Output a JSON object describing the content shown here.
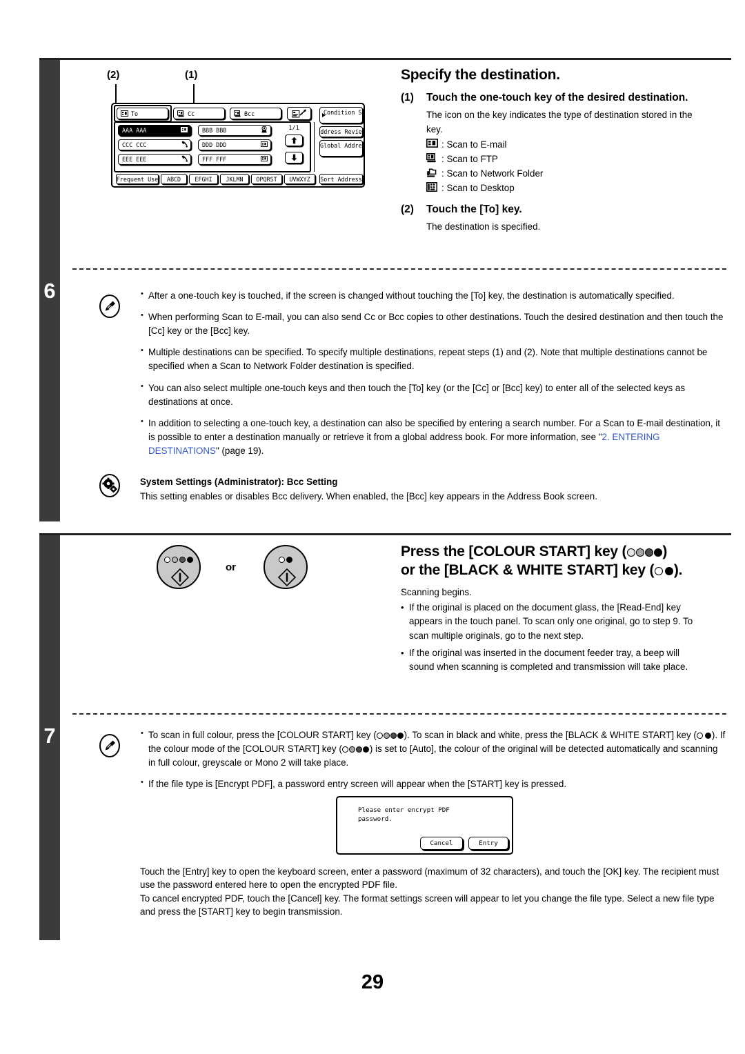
{
  "page": {
    "number": "29"
  },
  "steps": [
    {
      "number": "6",
      "heading": "Specify the destination.",
      "substeps": [
        {
          "marker": "(1)",
          "title": "Touch the one-touch key of the desired destination.",
          "body": "The icon on the key indicates the type of destination stored in the key.",
          "icon_legend": [
            {
              "icon": "scan-to-email-icon",
              "label": ": Scan to E-mail"
            },
            {
              "icon": "scan-to-ftp-icon",
              "label": ": Scan to FTP"
            },
            {
              "icon": "scan-to-network-folder-icon",
              "label": ": Scan to Network Folder"
            },
            {
              "icon": "scan-to-desktop-icon",
              "label": ": Scan to Desktop"
            }
          ]
        },
        {
          "marker": "(2)",
          "title": "Touch the [To] key.",
          "body": "The destination is specified."
        }
      ],
      "notes": [
        "After a one-touch key is touched, if the screen is changed without touching the [To] key, the destination is automatically specified.",
        "When performing Scan to E-mail, you can also send Cc or Bcc copies to other destinations. Touch the desired destination and then touch the [Cc] key or the [Bcc] key.",
        "Multiple destinations can be specified. To specify multiple destinations, repeat steps (1) and (2). Note that multiple destinations cannot be specified when a Scan to Network Folder destination is specified.",
        "You can also select multiple one-touch keys and then touch the [To] key (or the [Cc] or [Bcc] key) to enter all of the selected keys as destinations at once."
      ],
      "note_with_link": {
        "before": "In addition to selecting a one-touch key, a destination can also be specified by entering a search number. For a Scan to E-mail destination, it is possible to enter a destination manually or retrieve it from a global address book. For more information, see \"",
        "link": "2. ENTERING DESTINATIONS",
        "after": "\" (page 19)."
      },
      "system_settings": {
        "title": "System Settings (Administrator): Bcc Setting",
        "body": "This setting enables or disables Bcc delivery. When enabled, the [Bcc] key appears in the Address Book screen."
      },
      "panel": {
        "callouts": [
          {
            "label": "(2)"
          },
          {
            "label": "(1)"
          }
        ],
        "header_keys": [
          {
            "label": "To",
            "icon": "to-email-icon"
          },
          {
            "label": "Cc",
            "icon": "cc-email-icon"
          },
          {
            "label": "Bcc",
            "icon": "bcc-email-icon"
          }
        ],
        "compose_icon": "address-entry-icon",
        "address_keys": [
          {
            "label": "AAA AAA",
            "icon": "email-icon",
            "selected": true
          },
          {
            "label": "BBB BBB",
            "icon": "desktop-icon",
            "selected": false
          },
          {
            "label": "CCC CCC",
            "icon": "fax-icon",
            "selected": false
          },
          {
            "label": "DDD DDD",
            "icon": "email-icon",
            "selected": false
          },
          {
            "label": "EEE EEE",
            "icon": "fax-icon",
            "selected": false
          },
          {
            "label": "FFF FFF",
            "icon": "email-icon",
            "selected": false
          }
        ],
        "page_indicator": "1/1",
        "scroll_up": "scroll-up-arrow-icon",
        "scroll_down": "scroll-down-arrow-icon",
        "side_buttons": [
          {
            "label": "Condition Settings",
            "arrow": true
          },
          {
            "label": "Address Review",
            "arrow": false
          },
          {
            "label": "Global Address Search",
            "arrow": false
          }
        ],
        "tabs": [
          "Frequent Use",
          "ABCD",
          "EFGHI",
          "JKLMN",
          "OPQRST",
          "UVWXYZ"
        ],
        "sort_button": "Sort Address"
      }
    },
    {
      "number": "7",
      "heading_line1_pre": "Press the [COLOUR START] key (",
      "heading_line1_post": ")",
      "heading_line2_pre": "or the [BLACK & WHITE START] key (",
      "heading_line2_post": ").",
      "body": "Scanning begins.",
      "bullets": [
        "If the original is placed on the document glass, the [Read-End] key appears in the touch panel. To scan only one original, go to step 9. To scan multiple originals, go to the next step.",
        "If the original was inserted in the document feeder tray, a beep will sound when scanning is completed and transmission will take place."
      ],
      "or_label": "or",
      "notes": [
        {
          "parts": [
            "To scan in full colour, press the [COLOUR START] key (",
            "). To scan in black and white, press the [BLACK & WHITE START] key (",
            "). If the colour mode of the [COLOUR START] key (",
            ") is set to [Auto], the colour of the original will be detected automatically and scanning in full colour, greyscale or Mono 2 will take place."
          ]
        }
      ],
      "note_simple": "If the file type is [Encrypt PDF], a password entry screen will appear when the [START] key is pressed.",
      "dialog": {
        "message": "Please enter encrypt PDF\npassword.",
        "cancel": "Cancel",
        "entry": "Entry"
      },
      "footer_paragraphs": [
        "Touch the [Entry] key to open the keyboard screen, enter a password (maximum of 32 characters), and touch the [OK] key. The recipient must use the password entered here to open the encrypted PDF file.",
        "To cancel encrypted PDF, touch the [Cancel] key. The format settings screen will appear to let you change the file type. Select a new file type and press the [START] key to begin transmission."
      ]
    }
  ],
  "colors": {
    "link": "#3355cc",
    "bar": "#3b3b3b",
    "rule": "#231f20",
    "key_grey": "#c9c9c9"
  }
}
